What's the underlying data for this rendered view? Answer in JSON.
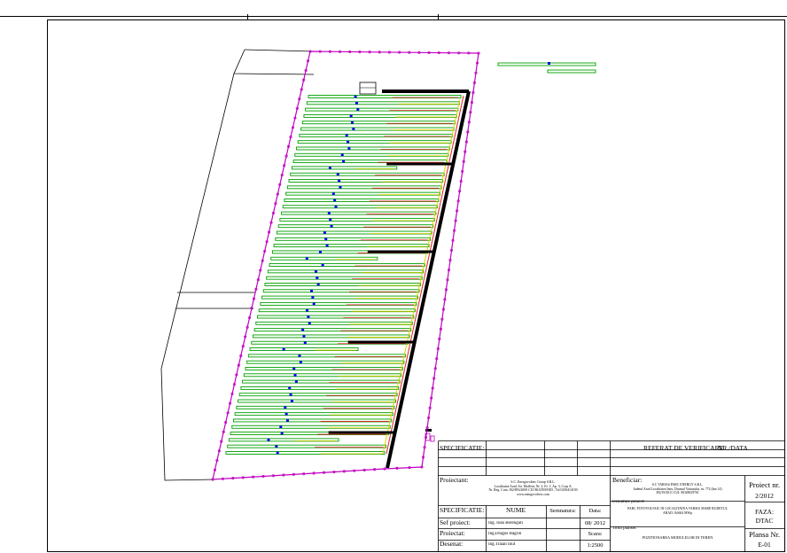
{
  "colors": {
    "boundary": "#c000c0",
    "panel_outline": "#00a000",
    "cable_red": "#e02020",
    "cable_yellow": "#e0d000",
    "trench": "#000000",
    "marker": "#0000ff"
  },
  "title_block": {
    "specificatie_label": "SPECIFICATIE:",
    "referat_label": "REFERAT DE VERIFICARE",
    "nr_data_label": "NR./DATA",
    "proiectant_label": "Proiectant:",
    "proiectant_lines": [
      "S.C. Energovolteic Group S.R.L.",
      "Localitatea Arad, Str. Mofleni, Nr. 2, Et. 1, Ap. 3, Corp A,",
      "Nr. Reg. Com. J02/893/2009 CUI RO25919383 , Tel 0256414150",
      "www.energovolteic.com"
    ],
    "beneficiar_label": "Beneficiar:",
    "beneficiar_lines": [
      "S.C VARIAS PARC ENERGY S.R.L.",
      "Judetul Arad Localitatea Ineu, Drumul Variasului, nr. 772 (km 14)",
      "J02/19/2011 CUI: RO28029701"
    ],
    "proiect_nr_label": "Proiect nr.",
    "proiect_nr": "2/2012",
    "denumire_label": "Denumire proiect:",
    "denumire_lines": [
      "PARC FOTOVOLTAIC IN LOCALITATEA VARSIU MARE RUDETUL",
      "ARAD, 8,6604 MWp"
    ],
    "faza_label": "FAZA:",
    "faza": "DTAC",
    "col_specificatie": "SPECIFICATIE:",
    "col_nume": "NUME",
    "col_semnatura": "Semnatura:",
    "col_data": "Data:",
    "rows": [
      {
        "role": "Sef proiect:",
        "name": "Ing. Ioan Berenguti"
      },
      {
        "role": "Proiectat:",
        "name": "Ing.Dragos Bagrin"
      },
      {
        "role": "Desenat:",
        "name": "Ing.Traian Inut"
      }
    ],
    "date": "08/ 2012",
    "scara_label": "Scara:",
    "scara": "1:2500",
    "titlu_label": "Titlul plansei:",
    "titlu": "POZITIONAREA  MODULELOR IN TEREN",
    "plansa_label": "Plansa Nr.",
    "plansa": "E-01"
  }
}
